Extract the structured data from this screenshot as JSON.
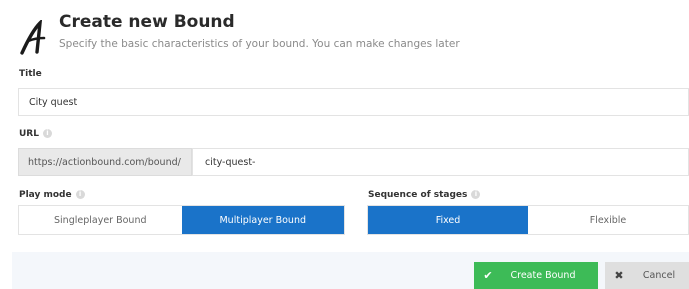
{
  "header": {
    "title": "Create new Bound",
    "subtitle": "Specify the basic characteristics of your bound. You can make changes later"
  },
  "title_field": {
    "label": "Title",
    "value": "City quest"
  },
  "url_field": {
    "label": "URL",
    "prefix": "https://actionbound.com/bound/",
    "value": "city-quest-"
  },
  "play_mode": {
    "label": "Play mode",
    "options": [
      "Singleplayer Bound",
      "Multiplayer Bound"
    ],
    "selected": "Multiplayer Bound"
  },
  "sequence": {
    "label": "Sequence of stages",
    "options": [
      "Fixed",
      "Flexible"
    ],
    "selected": "Fixed"
  },
  "footer": {
    "create_label": "Create Bound",
    "cancel_label": "Cancel"
  },
  "colors": {
    "primary": "#1a73c9",
    "create": "#3dbb57",
    "cancel": "#dfdfdf"
  }
}
